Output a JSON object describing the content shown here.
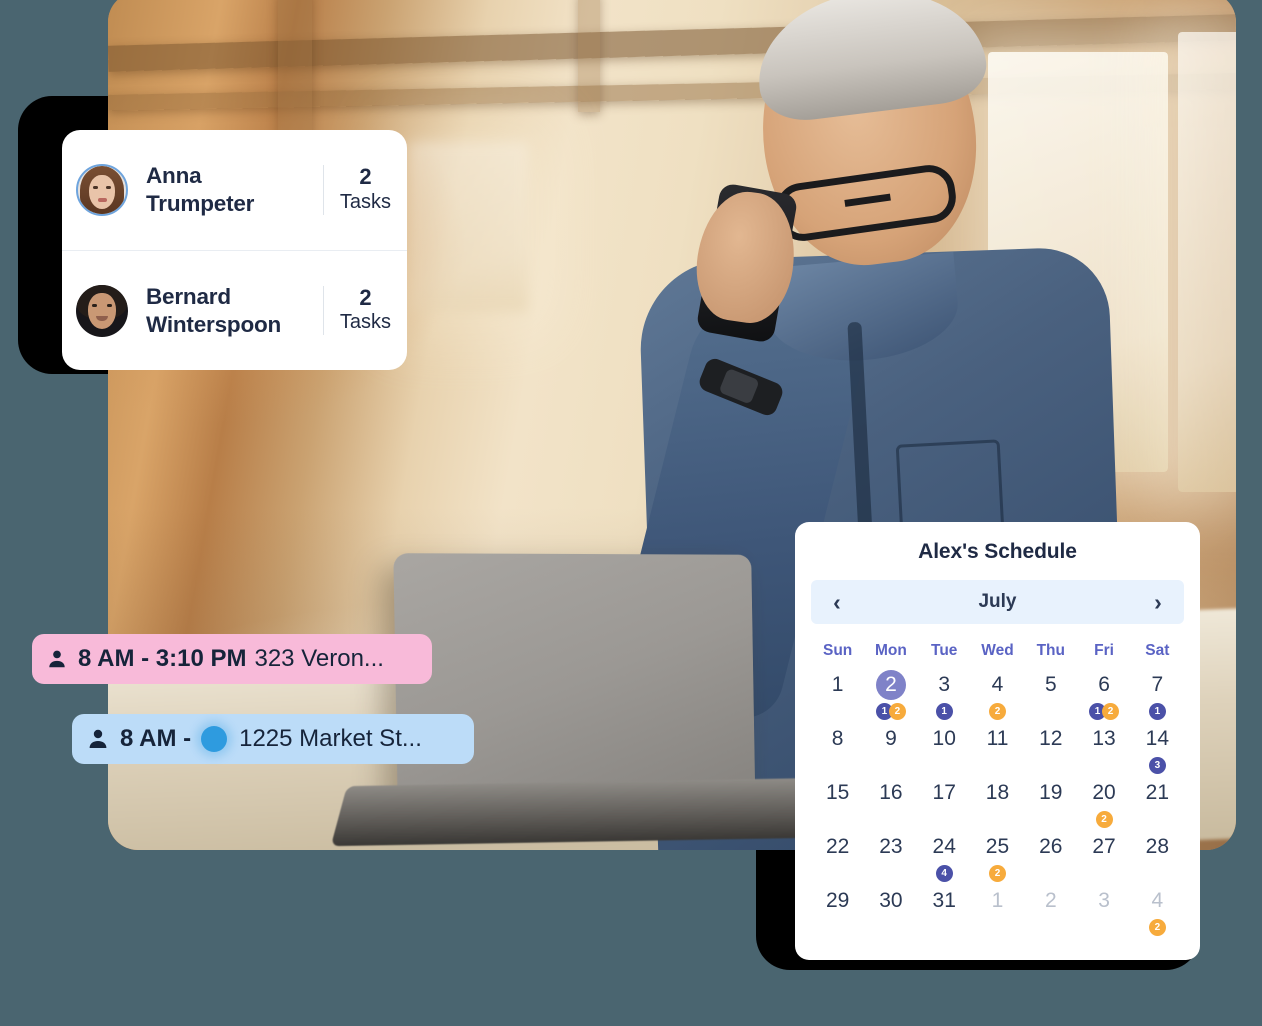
{
  "theme": {
    "page_background": "#4a6570",
    "card_background": "#ffffff",
    "text_primary": "#1f2a44",
    "accent_indigo": "#4b51a8",
    "accent_purple": "#7f82c8",
    "accent_orange": "#f7ab3c",
    "nav_bar_background": "#e8f2fd",
    "pill_pink": "#f8bad9",
    "pill_blue": "#bcdcf8",
    "status_dot_blue": "#2e9bdf",
    "weekday_label": "#5a63c4"
  },
  "hero_photo": {
    "alt": "man in denim shirt on phone at laptop in workshop",
    "icon": "photo-image"
  },
  "tasks_card": {
    "rows": [
      {
        "avatar_icon": "avatar-anna",
        "name": "Anna Trumpeter",
        "name_line1": "Anna",
        "name_line2": "Trumpeter",
        "count": "2",
        "count_label": "Tasks"
      },
      {
        "avatar_icon": "avatar-bernard",
        "name": "Bernard Winterspoon",
        "name_line1": "Bernard",
        "name_line2": "Winterspoon",
        "count": "2",
        "count_label": "Tasks"
      }
    ]
  },
  "appointments": [
    {
      "id": "pink",
      "person_icon": "person-icon",
      "time": "8 AM - 3:10 PM",
      "address": "323 Veron...",
      "color": "#f8bad9",
      "has_status_dot": false
    },
    {
      "id": "blue",
      "person_icon": "person-icon",
      "time": "8 AM -",
      "address": "1225 Market St...",
      "color": "#bcdcf8",
      "has_status_dot": true,
      "status_dot_icon": "status-dot-icon"
    }
  ],
  "calendar": {
    "title": "Alex's Schedule",
    "month": "July",
    "prev_icon": "chevron-left-icon",
    "next_icon": "chevron-right-icon",
    "prev_label": "‹",
    "next_label": "›",
    "weekdays": [
      "Sun",
      "Mon",
      "Tue",
      "Wed",
      "Thu",
      "Fri",
      "Sat"
    ],
    "weeks": [
      [
        {
          "d": "1",
          "muted": false,
          "selected": false,
          "badges": []
        },
        {
          "d": "2",
          "muted": false,
          "selected": true,
          "badges": [
            {
              "v": "1",
              "c": "indigo"
            },
            {
              "v": "2",
              "c": "orange"
            }
          ]
        },
        {
          "d": "3",
          "muted": false,
          "selected": false,
          "badges": [
            {
              "v": "1",
              "c": "indigo"
            }
          ]
        },
        {
          "d": "4",
          "muted": false,
          "selected": false,
          "badges": [
            {
              "v": "2",
              "c": "orange"
            }
          ]
        },
        {
          "d": "5",
          "muted": false,
          "selected": false,
          "badges": []
        },
        {
          "d": "6",
          "muted": false,
          "selected": false,
          "badges": [
            {
              "v": "1",
              "c": "indigo"
            },
            {
              "v": "2",
              "c": "orange"
            }
          ]
        },
        {
          "d": "7",
          "muted": false,
          "selected": false,
          "badges": [
            {
              "v": "1",
              "c": "indigo"
            }
          ]
        }
      ],
      [
        {
          "d": "8",
          "muted": false,
          "selected": false,
          "badges": []
        },
        {
          "d": "9",
          "muted": false,
          "selected": false,
          "badges": []
        },
        {
          "d": "10",
          "muted": false,
          "selected": false,
          "badges": []
        },
        {
          "d": "11",
          "muted": false,
          "selected": false,
          "badges": []
        },
        {
          "d": "12",
          "muted": false,
          "selected": false,
          "badges": []
        },
        {
          "d": "13",
          "muted": false,
          "selected": false,
          "badges": []
        },
        {
          "d": "14",
          "muted": false,
          "selected": false,
          "badges": [
            {
              "v": "3",
              "c": "indigo"
            }
          ]
        }
      ],
      [
        {
          "d": "15",
          "muted": false,
          "selected": false,
          "badges": []
        },
        {
          "d": "16",
          "muted": false,
          "selected": false,
          "badges": []
        },
        {
          "d": "17",
          "muted": false,
          "selected": false,
          "badges": []
        },
        {
          "d": "18",
          "muted": false,
          "selected": false,
          "badges": []
        },
        {
          "d": "19",
          "muted": false,
          "selected": false,
          "badges": []
        },
        {
          "d": "20",
          "muted": false,
          "selected": false,
          "badges": [
            {
              "v": "2",
              "c": "orange"
            }
          ]
        },
        {
          "d": "21",
          "muted": false,
          "selected": false,
          "badges": []
        }
      ],
      [
        {
          "d": "22",
          "muted": false,
          "selected": false,
          "badges": []
        },
        {
          "d": "23",
          "muted": false,
          "selected": false,
          "badges": []
        },
        {
          "d": "24",
          "muted": false,
          "selected": false,
          "badges": [
            {
              "v": "4",
              "c": "indigo"
            }
          ]
        },
        {
          "d": "25",
          "muted": false,
          "selected": false,
          "badges": [
            {
              "v": "2",
              "c": "orange"
            }
          ]
        },
        {
          "d": "26",
          "muted": false,
          "selected": false,
          "badges": []
        },
        {
          "d": "27",
          "muted": false,
          "selected": false,
          "badges": []
        },
        {
          "d": "28",
          "muted": false,
          "selected": false,
          "badges": []
        }
      ],
      [
        {
          "d": "29",
          "muted": false,
          "selected": false,
          "badges": []
        },
        {
          "d": "30",
          "muted": false,
          "selected": false,
          "badges": []
        },
        {
          "d": "31",
          "muted": false,
          "selected": false,
          "badges": []
        },
        {
          "d": "1",
          "muted": true,
          "selected": false,
          "badges": []
        },
        {
          "d": "2",
          "muted": true,
          "selected": false,
          "badges": []
        },
        {
          "d": "3",
          "muted": true,
          "selected": false,
          "badges": []
        },
        {
          "d": "4",
          "muted": true,
          "selected": false,
          "badges": [
            {
              "v": "2",
              "c": "orange"
            }
          ]
        }
      ]
    ]
  }
}
